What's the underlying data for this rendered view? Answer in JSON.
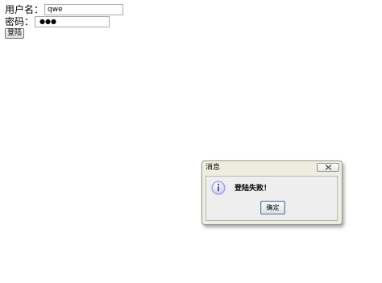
{
  "form": {
    "username_label": "用户名：",
    "username_value": "qwe",
    "password_label": "密码：",
    "password_mask": "●●●",
    "login_button": "登陆"
  },
  "dialog": {
    "title": "消息",
    "message": "登陆失败！",
    "ok_button": "确定",
    "icon": "info-icon",
    "close_icon": "close-icon"
  },
  "colors": {
    "dialog_background": "#eeeee0",
    "info_icon": "#8c8fe0"
  }
}
